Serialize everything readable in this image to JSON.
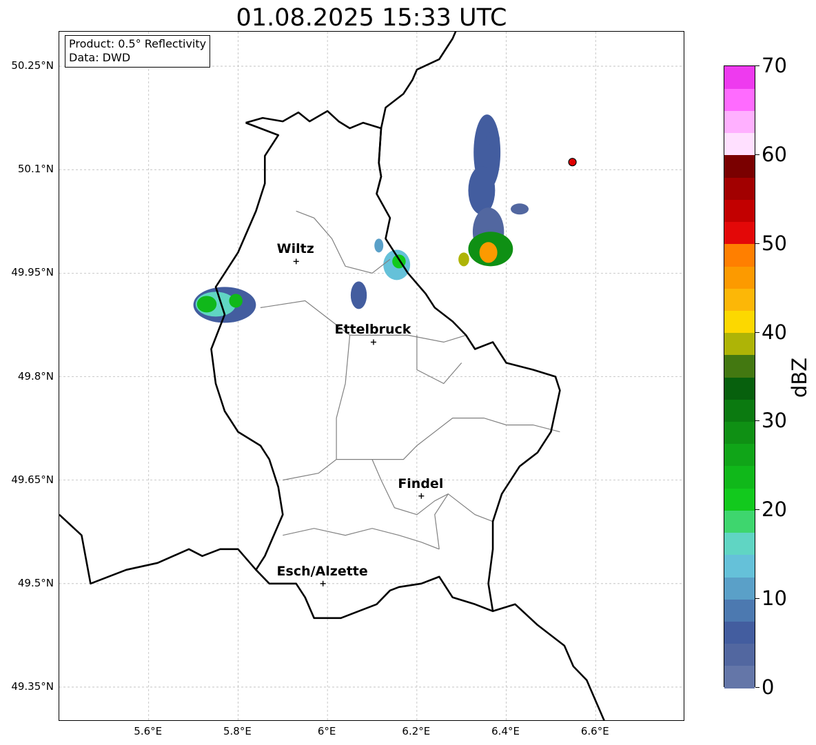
{
  "title": "01.08.2025 15:33 UTC",
  "info_box": {
    "product": "Product: 0.5° Reflectivity",
    "data": "Data: DWD"
  },
  "map": {
    "extent": {
      "lon_min": 5.4,
      "lon_max": 6.8,
      "lat_min": 49.3,
      "lat_max": 50.3
    },
    "lat_ticks": [
      {
        "value": 50.25,
        "label": "50.25°N"
      },
      {
        "value": 50.1,
        "label": "50.1°N"
      },
      {
        "value": 49.95,
        "label": "49.95°N"
      },
      {
        "value": 49.8,
        "label": "49.8°N"
      },
      {
        "value": 49.65,
        "label": "49.65°N"
      },
      {
        "value": 49.5,
        "label": "49.5°N"
      },
      {
        "value": 49.35,
        "label": "49.35°N"
      }
    ],
    "lon_ticks": [
      {
        "value": 5.6,
        "label": "5.6°E"
      },
      {
        "value": 5.8,
        "label": "5.8°E"
      },
      {
        "value": 6.0,
        "label": "6°E"
      },
      {
        "value": 6.2,
        "label": "6.2°E"
      },
      {
        "value": 6.4,
        "label": "6.4°E"
      },
      {
        "value": 6.6,
        "label": "6.6°E"
      }
    ],
    "gridlines": true,
    "cities": [
      {
        "name": "Wiltz",
        "lon": 5.93,
        "lat": 49.967
      },
      {
        "name": "Ettelbruck",
        "lon": 6.103,
        "lat": 49.85
      },
      {
        "name": "Findel",
        "lon": 6.21,
        "lat": 49.627
      },
      {
        "name": "Esch/Alzette",
        "lon": 5.99,
        "lat": 49.5
      }
    ],
    "marker": {
      "lon": 6.548,
      "lat": 50.111,
      "color": "#e00000"
    },
    "colors": {
      "national_border": "#000000",
      "canton_border": "#808080",
      "grid": "#bbbbbb"
    },
    "borders": {
      "luxembourg": [
        [
          5.817,
          50.168
        ],
        [
          5.855,
          50.175
        ],
        [
          5.9,
          50.17
        ],
        [
          5.935,
          50.183
        ],
        [
          5.96,
          50.17
        ],
        [
          6.0,
          50.185
        ],
        [
          6.025,
          50.17
        ],
        [
          6.05,
          50.16
        ],
        [
          6.08,
          50.168
        ],
        [
          6.12,
          50.16
        ],
        [
          6.117,
          50.13
        ],
        [
          6.115,
          50.11
        ],
        [
          6.12,
          50.09
        ],
        [
          6.11,
          50.065
        ],
        [
          6.14,
          50.03
        ],
        [
          6.13,
          50.0
        ],
        [
          6.16,
          49.97
        ],
        [
          6.18,
          49.95
        ],
        [
          6.22,
          49.92
        ],
        [
          6.24,
          49.9
        ],
        [
          6.28,
          49.88
        ],
        [
          6.31,
          49.86
        ],
        [
          6.33,
          49.84
        ],
        [
          6.37,
          49.85
        ],
        [
          6.4,
          49.82
        ],
        [
          6.46,
          49.81
        ],
        [
          6.51,
          49.8
        ],
        [
          6.52,
          49.78
        ],
        [
          6.5,
          49.72
        ],
        [
          6.47,
          49.69
        ],
        [
          6.43,
          49.67
        ],
        [
          6.39,
          49.63
        ],
        [
          6.37,
          49.59
        ],
        [
          6.37,
          49.55
        ],
        [
          6.36,
          49.5
        ],
        [
          6.37,
          49.46
        ],
        [
          6.33,
          49.47
        ],
        [
          6.28,
          49.48
        ],
        [
          6.25,
          49.51
        ],
        [
          6.21,
          49.5
        ],
        [
          6.16,
          49.495
        ],
        [
          6.14,
          49.49
        ],
        [
          6.11,
          49.47
        ],
        [
          6.07,
          49.46
        ],
        [
          6.03,
          49.45
        ],
        [
          5.97,
          49.45
        ],
        [
          5.95,
          49.48
        ],
        [
          5.93,
          49.5
        ],
        [
          5.89,
          49.5
        ],
        [
          5.87,
          49.5
        ],
        [
          5.84,
          49.52
        ],
        [
          5.86,
          49.54
        ],
        [
          5.88,
          49.57
        ],
        [
          5.9,
          49.6
        ],
        [
          5.89,
          49.64
        ],
        [
          5.87,
          49.68
        ],
        [
          5.85,
          49.7
        ],
        [
          5.8,
          49.72
        ],
        [
          5.77,
          49.75
        ],
        [
          5.75,
          49.79
        ],
        [
          5.74,
          49.84
        ],
        [
          5.77,
          49.89
        ],
        [
          5.75,
          49.93
        ],
        [
          5.78,
          49.96
        ],
        [
          5.8,
          49.98
        ],
        [
          5.82,
          50.01
        ],
        [
          5.84,
          50.04
        ],
        [
          5.86,
          50.08
        ],
        [
          5.86,
          50.12
        ],
        [
          5.89,
          50.15
        ],
        [
          5.817,
          50.168
        ]
      ],
      "germany_west": [
        [
          6.3,
          50.32
        ],
        [
          6.28,
          50.29
        ],
        [
          6.25,
          50.26
        ],
        [
          6.2,
          50.245
        ],
        [
          6.19,
          50.23
        ],
        [
          6.17,
          50.21
        ],
        [
          6.13,
          50.19
        ],
        [
          6.12,
          50.16
        ],
        [
          6.117,
          50.13
        ],
        [
          6.115,
          50.11
        ],
        [
          6.12,
          50.09
        ],
        [
          6.11,
          50.065
        ]
      ],
      "belgium_france": [
        [
          5.4,
          49.6
        ],
        [
          5.45,
          49.57
        ],
        [
          5.47,
          49.5
        ],
        [
          5.51,
          49.51
        ],
        [
          5.55,
          49.52
        ],
        [
          5.62,
          49.53
        ],
        [
          5.69,
          49.55
        ],
        [
          5.72,
          49.54
        ],
        [
          5.76,
          49.55
        ],
        [
          5.8,
          49.55
        ],
        [
          5.84,
          49.52
        ]
      ],
      "germany_east": [
        [
          6.37,
          49.46
        ],
        [
          6.42,
          49.47
        ],
        [
          6.47,
          49.44
        ],
        [
          6.53,
          49.41
        ],
        [
          6.55,
          49.38
        ],
        [
          6.58,
          49.36
        ],
        [
          6.6,
          49.33
        ],
        [
          6.62,
          49.3
        ]
      ],
      "cantons": [
        [
          [
            5.93,
            50.04
          ],
          [
            5.97,
            50.03
          ],
          [
            6.01,
            50.0
          ],
          [
            6.04,
            49.96
          ],
          [
            6.1,
            49.95
          ],
          [
            6.14,
            49.97
          ]
        ],
        [
          [
            5.85,
            49.9
          ],
          [
            5.95,
            49.91
          ],
          [
            6.01,
            49.88
          ],
          [
            6.05,
            49.86
          ],
          [
            6.12,
            49.86
          ],
          [
            6.18,
            49.86
          ],
          [
            6.26,
            49.85
          ],
          [
            6.31,
            49.86
          ]
        ],
        [
          [
            6.05,
            49.86
          ],
          [
            6.04,
            49.79
          ],
          [
            6.02,
            49.74
          ],
          [
            6.02,
            49.68
          ],
          [
            5.98,
            49.66
          ],
          [
            5.9,
            49.65
          ]
        ],
        [
          [
            6.2,
            49.86
          ],
          [
            6.2,
            49.81
          ],
          [
            6.26,
            49.79
          ],
          [
            6.3,
            49.82
          ]
        ],
        [
          [
            6.02,
            49.68
          ],
          [
            6.1,
            49.68
          ],
          [
            6.17,
            49.68
          ],
          [
            6.2,
            49.7
          ],
          [
            6.28,
            49.74
          ],
          [
            6.35,
            49.74
          ],
          [
            6.4,
            49.73
          ],
          [
            6.46,
            49.73
          ],
          [
            6.52,
            49.72
          ]
        ],
        [
          [
            6.1,
            49.68
          ],
          [
            6.12,
            49.65
          ],
          [
            6.15,
            49.61
          ],
          [
            6.2,
            49.6
          ],
          [
            6.24,
            49.62
          ],
          [
            6.27,
            49.63
          ]
        ],
        [
          [
            5.9,
            49.57
          ],
          [
            5.97,
            49.58
          ],
          [
            6.04,
            49.57
          ],
          [
            6.1,
            49.58
          ],
          [
            6.16,
            49.57
          ],
          [
            6.21,
            49.56
          ],
          [
            6.25,
            49.55
          ]
        ],
        [
          [
            6.25,
            49.55
          ],
          [
            6.24,
            49.6
          ],
          [
            6.27,
            49.63
          ],
          [
            6.29,
            49.62
          ],
          [
            6.33,
            49.6
          ],
          [
            6.37,
            49.59
          ]
        ]
      ]
    },
    "radar_echoes": [
      {
        "lon": 6.357,
        "lat": 50.125,
        "rx": 0.03,
        "ry": 0.055,
        "dbz": 5
      },
      {
        "lon": 6.37,
        "lat": 50.145,
        "rx": 0.015,
        "ry": 0.01,
        "dbz": 5
      },
      {
        "lon": 6.345,
        "lat": 50.07,
        "rx": 0.03,
        "ry": 0.035,
        "dbz": 5
      },
      {
        "lon": 6.36,
        "lat": 50.01,
        "rx": 0.035,
        "ry": 0.035,
        "dbz": 4
      },
      {
        "lon": 6.43,
        "lat": 50.043,
        "rx": 0.02,
        "ry": 0.008,
        "dbz": 4
      },
      {
        "lon": 6.365,
        "lat": 49.985,
        "rx": 0.05,
        "ry": 0.025,
        "dbz": 28
      },
      {
        "lon": 6.36,
        "lat": 49.98,
        "rx": 0.02,
        "ry": 0.015,
        "dbz": 45
      },
      {
        "lon": 6.305,
        "lat": 49.97,
        "rx": 0.012,
        "ry": 0.01,
        "dbz": 38
      },
      {
        "lon": 6.155,
        "lat": 49.962,
        "rx": 0.03,
        "ry": 0.022,
        "dbz": 14
      },
      {
        "lon": 6.16,
        "lat": 49.967,
        "rx": 0.015,
        "ry": 0.01,
        "dbz": 22
      },
      {
        "lon": 6.115,
        "lat": 49.99,
        "rx": 0.01,
        "ry": 0.01,
        "dbz": 10
      },
      {
        "lon": 6.07,
        "lat": 49.918,
        "rx": 0.018,
        "ry": 0.02,
        "dbz": 6
      },
      {
        "lon": 5.77,
        "lat": 49.904,
        "rx": 0.07,
        "ry": 0.026,
        "dbz": 6
      },
      {
        "lon": 5.75,
        "lat": 49.905,
        "rx": 0.045,
        "ry": 0.018,
        "dbz": 17
      },
      {
        "lon": 5.73,
        "lat": 49.905,
        "rx": 0.022,
        "ry": 0.012,
        "dbz": 24
      },
      {
        "lon": 5.795,
        "lat": 49.91,
        "rx": 0.015,
        "ry": 0.01,
        "dbz": 24
      }
    ]
  },
  "colorbar": {
    "label": "dBZ",
    "min": 0,
    "max": 70,
    "tick_labels": [
      "0",
      "10",
      "20",
      "30",
      "40",
      "50",
      "60",
      "70"
    ],
    "colors": [
      "#6476a8",
      "#5267a0",
      "#435d9f",
      "#4c79b0",
      "#5aa0c8",
      "#65c1d9",
      "#60d5c3",
      "#3ed66e",
      "#12c91d",
      "#10b81a",
      "#10a518",
      "#0f9014",
      "#0b7a10",
      "#07600d",
      "#437811",
      "#aeb406",
      "#fcd800",
      "#fcb707",
      "#fc9a00",
      "#ff7f00",
      "#e30808",
      "#c20000",
      "#a20000",
      "#7a0000",
      "#ffe0ff",
      "#ffb0ff",
      "#ff6bff",
      "#ee3aef"
    ]
  }
}
